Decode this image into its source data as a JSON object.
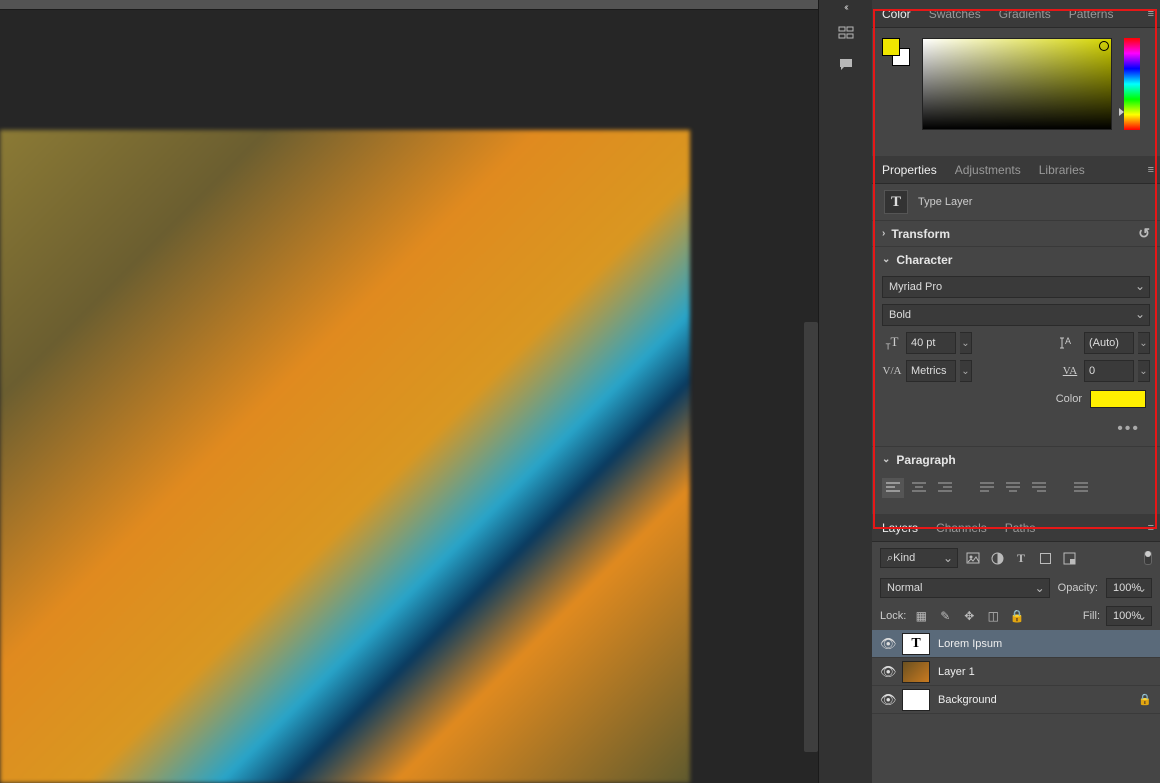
{
  "color_panel": {
    "tabs": [
      "Color",
      "Swatches",
      "Gradients",
      "Patterns"
    ],
    "active_tab": "Color",
    "foreground": "#f0e600",
    "background": "#ffffff"
  },
  "properties_panel": {
    "tabs": [
      "Properties",
      "Adjustments",
      "Libraries"
    ],
    "active_tab": "Properties",
    "layer_type": "Type Layer",
    "sections": {
      "transform": {
        "title": "Transform",
        "expanded": false
      },
      "character": {
        "title": "Character",
        "expanded": true,
        "font_family": "Myriad Pro",
        "font_style": "Bold",
        "font_size": "40 pt",
        "leading": "(Auto)",
        "kerning": "Metrics",
        "tracking": "0",
        "color_label": "Color",
        "color": "#fff000"
      },
      "paragraph": {
        "title": "Paragraph",
        "expanded": true
      }
    }
  },
  "layers_panel": {
    "tabs": [
      "Layers",
      "Channels",
      "Paths"
    ],
    "active_tab": "Layers",
    "filter_kind_label": "Kind",
    "blend_mode": "Normal",
    "opacity_label": "Opacity:",
    "opacity_value": "100%",
    "lock_label": "Lock:",
    "fill_label": "Fill:",
    "fill_value": "100%",
    "layers": [
      {
        "name": "Lorem Ipsum",
        "type": "type",
        "visible": true,
        "selected": true,
        "locked": false
      },
      {
        "name": "Layer 1",
        "type": "image",
        "visible": true,
        "selected": false,
        "locked": false
      },
      {
        "name": "Background",
        "type": "background",
        "visible": true,
        "selected": false,
        "locked": true
      }
    ]
  },
  "icons": {
    "search_prefix": "⌕"
  }
}
